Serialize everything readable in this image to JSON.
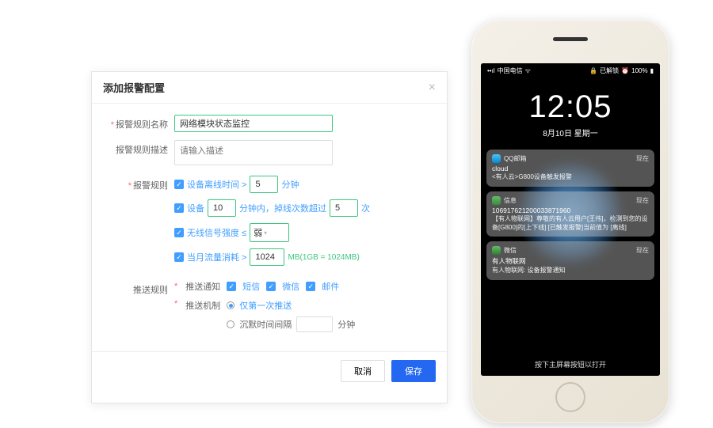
{
  "modal": {
    "title": "添加报警配置",
    "labels": {
      "ruleName": "报警规则名称",
      "ruleDesc": "报警规则描述",
      "ruleConfig": "报警规则",
      "pushRule": "推送规则"
    },
    "ruleName": "网络模块状态监控",
    "ruleDescPlaceholder": "请输入描述",
    "rules": {
      "offline": {
        "check": true,
        "label": "设备离线时间 >",
        "value": "5",
        "unit": "分钟"
      },
      "drop": {
        "check": true,
        "label": "设备",
        "minutes": "10",
        "midLabel": "分钟内，掉线次数超过",
        "times": "5",
        "unit": "次"
      },
      "signal": {
        "check": true,
        "label": "无线信号强度 ≤",
        "value": "弱"
      },
      "traffic": {
        "check": true,
        "label": "当月流量消耗 >",
        "value": "1024",
        "unit": "MB(1GB = 1024MB)"
      }
    },
    "push": {
      "notify": {
        "label": "推送通知",
        "sms": {
          "check": true,
          "label": "短信"
        },
        "wechat": {
          "check": true,
          "label": "微信"
        },
        "email": {
          "check": true,
          "label": "邮件"
        }
      },
      "mech": {
        "label": "推送机制",
        "once": "仅第一次推送",
        "silence": "沉默时间间隔",
        "silenceUnit": "分钟"
      }
    },
    "buttons": {
      "cancel": "取消",
      "save": "保存"
    }
  },
  "phone": {
    "status": {
      "carrier": "中国电信",
      "lock": "已解锁",
      "battery": "100%"
    },
    "time": "12:05",
    "date": "8月10日 星期一",
    "notifs": {
      "qq": {
        "app": "QQ邮箱",
        "time": "现在",
        "title": "cloud",
        "body": "<有人云>G800设备触发报警"
      },
      "sms": {
        "app": "信息",
        "time": "现在",
        "title": "106917621200033871960",
        "body": "【有人物联网】尊敬的有人云用户[王伟]，检测到您的设备[G800]的[上下线] [已触发报警]当前值为 [离线]"
      },
      "wx": {
        "app": "微信",
        "time": "现在",
        "title": "有人物联网",
        "body": "有人物联网: 设备报警通知"
      }
    },
    "swipe": "按下主屏幕按钮以打开"
  }
}
